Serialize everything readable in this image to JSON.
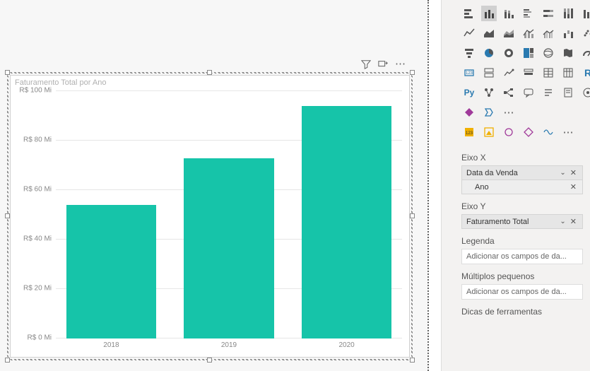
{
  "chart_data": {
    "type": "bar",
    "title": "Faturamento Total por Ano",
    "categories": [
      "2018",
      "2019",
      "2020"
    ],
    "values": [
      54,
      73,
      94
    ],
    "ylabel": "",
    "xlabel": "",
    "ylim": [
      0,
      100
    ],
    "y_ticks": [
      0,
      20,
      40,
      60,
      80,
      100
    ],
    "y_tick_labels": [
      "R$ 0 Mi",
      "R$ 20 Mi",
      "R$ 40 Mi",
      "R$ 60 Mi",
      "R$ 80 Mi",
      "R$ 100 Mi"
    ],
    "series_color": "#16c4a9"
  },
  "fields_pane": {
    "x_axis": {
      "label": "Eixo X",
      "field": "Data da Venda",
      "hierarchy_child": "Ano"
    },
    "y_axis": {
      "label": "Eixo Y",
      "field": "Faturamento Total"
    },
    "legend": {
      "label": "Legenda",
      "placeholder": "Adicionar os campos de da..."
    },
    "small_multiples": {
      "label": "Múltiplos pequenos",
      "placeholder": "Adicionar os campos de da..."
    },
    "tooltips": {
      "label": "Dicas de ferramentas"
    }
  },
  "viz_gallery": {
    "ellipsis": "⋯",
    "r_label": "R",
    "py_label": "Py"
  }
}
